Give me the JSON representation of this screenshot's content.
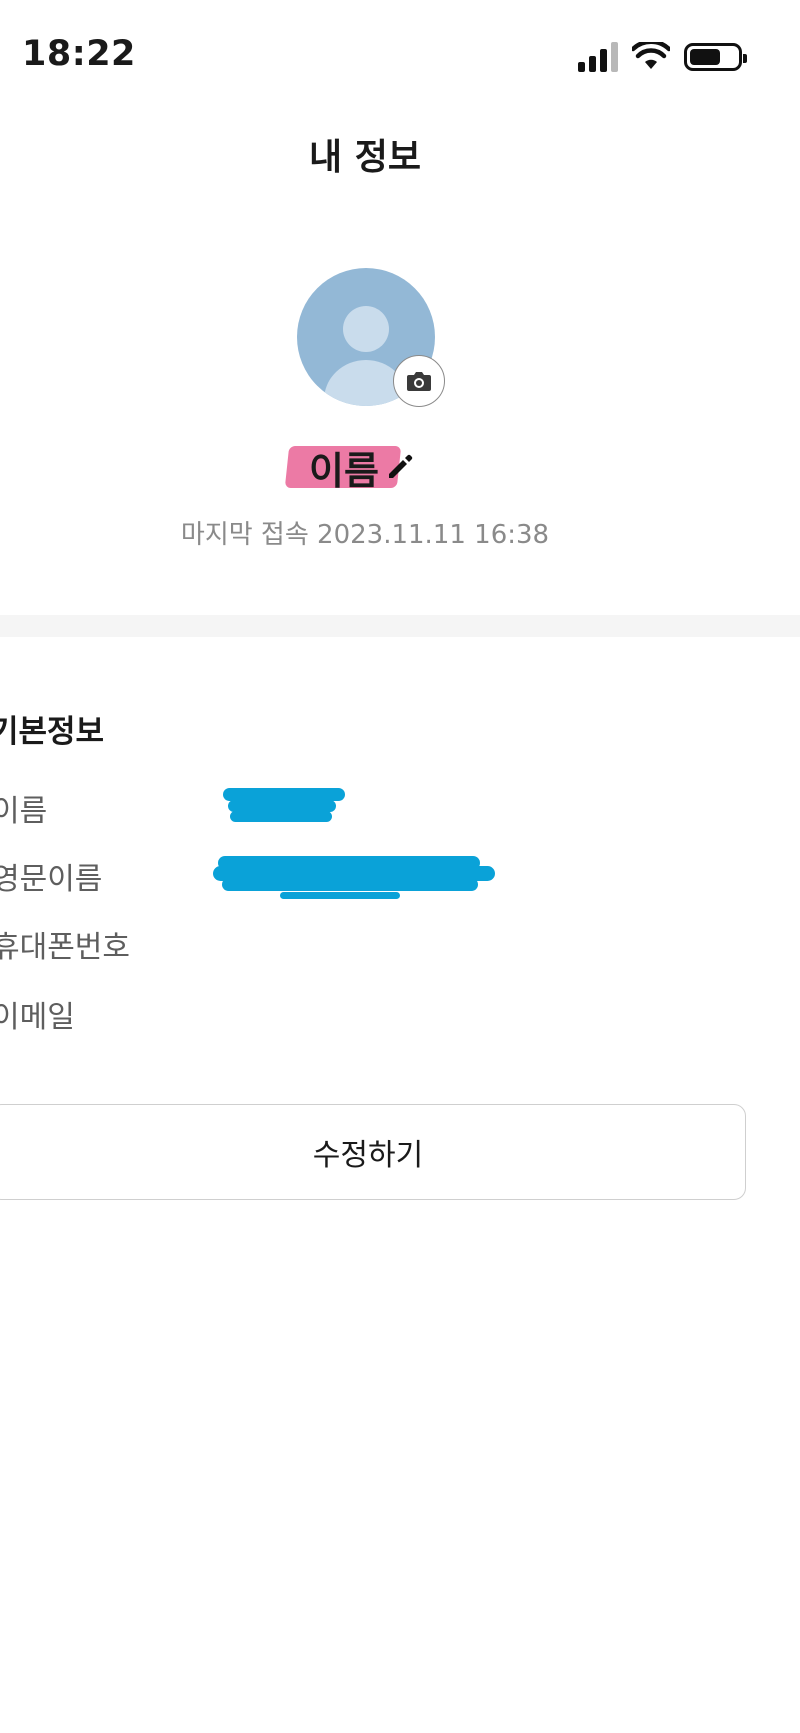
{
  "status_bar": {
    "time": "18:22",
    "battery_level": 0.6
  },
  "header": {
    "title": "내 정보"
  },
  "profile": {
    "name": "이름",
    "last_login": "마지막 접속 2023.11.11 16:38",
    "camera_icon": "camera-icon",
    "edit_icon": "pencil-icon"
  },
  "basic_info": {
    "title": "기본정보",
    "fields": [
      {
        "label": "이름"
      },
      {
        "label": "영문이름"
      },
      {
        "label": "휴대폰번호"
      },
      {
        "label": "이메일"
      }
    ]
  },
  "actions": {
    "edit_label": "수정하기"
  },
  "colors": {
    "name_highlight": "#ec7aa5",
    "redaction": "#0aa2d8",
    "avatar": "#93b8d6"
  }
}
